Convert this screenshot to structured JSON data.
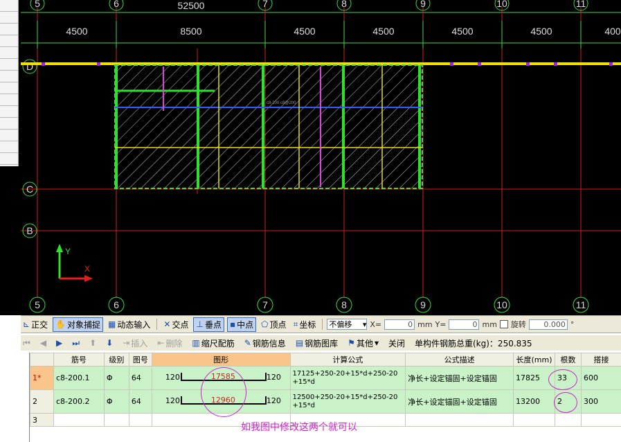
{
  "cad": {
    "axis_numbers_top": [
      "5",
      "6",
      "7",
      "8",
      "9",
      "10",
      "11"
    ],
    "axis_numbers_bottom": [
      "5",
      "6",
      "7",
      "8",
      "9",
      "10",
      "11"
    ],
    "axis_letters": [
      "D",
      "C",
      "B"
    ],
    "total_dimension": "52500",
    "dimensions": [
      "4500",
      "8500",
      "4500",
      "4500",
      "4500",
      "4500",
      "400"
    ],
    "beam_label": "c8-200 c8@200",
    "axis_x_label": "Y",
    "axis_y_label": "X"
  },
  "snapbar": {
    "ortho": "正交",
    "object_snap": "对象捕捉",
    "dynamic_input": "动态输入",
    "intersection": "交点",
    "perpendicular": "垂点",
    "midpoint": "中点",
    "vertex": "顶点",
    "coordinate": "坐标",
    "offset_mode": "不偏移",
    "x_label": "X=",
    "x_value": "0",
    "y_label": "Y=",
    "y_value": "0",
    "unit": "mm",
    "rotate_label": "旋转",
    "rotate_value": "0.000",
    "degree": "°"
  },
  "rebarbar": {
    "insert": "插入",
    "delete": "删除",
    "scale_rebar": "缩尺配筋",
    "rebar_info": "钢筋信息",
    "rebar_library": "钢筋图库",
    "other": "其他",
    "close": "关闭",
    "total_weight_label": "单构件钢筋总重(kg)：250.835"
  },
  "table": {
    "headers": [
      "筋号",
      "级别",
      "图号",
      "图形",
      "计算公式",
      "公式描述",
      "长度(mm)",
      "根数",
      "搭接"
    ],
    "rows": [
      {
        "num": "1*",
        "bar": "c8-200.1",
        "grade": "Φ",
        "fig": "64",
        "left": "120",
        "mid": "17585",
        "right": "120",
        "formula": "17125+250-20+15*d+250-20+15*d",
        "desc": "净长+设定锚固+设定锚固",
        "length": "17825",
        "count": "33",
        "lap": "600"
      },
      {
        "num": "2",
        "bar": "c8-200.2",
        "grade": "Φ",
        "fig": "64",
        "left": "120",
        "mid": "12960",
        "right": "120",
        "formula": "12500+250-20+15*d+250-20+15*d",
        "desc": "净长+设定锚固+设定锚固",
        "length": "13200",
        "count": "2",
        "lap": "300"
      },
      {
        "num": "3",
        "bar": "",
        "grade": "",
        "fig": "",
        "left": "",
        "mid": "",
        "right": "",
        "formula": "",
        "desc": "",
        "length": "",
        "count": "",
        "lap": ""
      }
    ]
  },
  "annotation": "如我图中修改这两个就可以"
}
